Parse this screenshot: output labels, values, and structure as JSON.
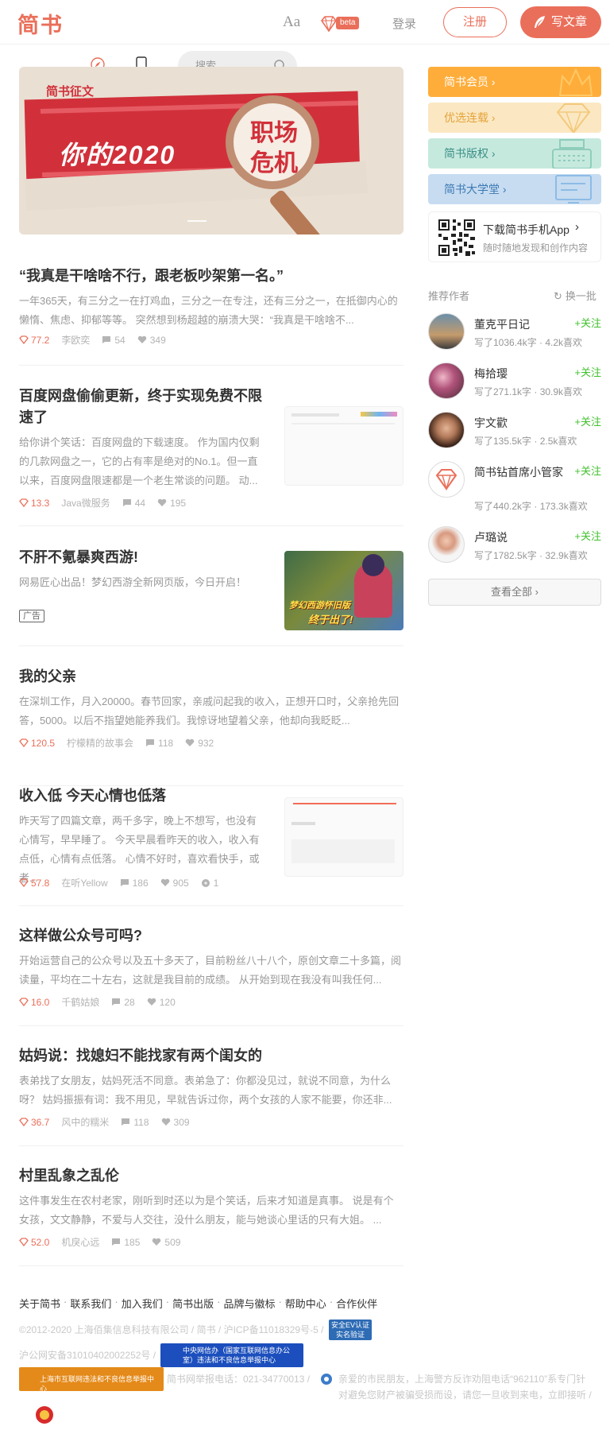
{
  "header": {
    "logo": "简书",
    "font_toggle": "Aa",
    "beta": "beta",
    "login": "登录",
    "register": "注册",
    "write": "写文章"
  },
  "search": {
    "placeholder": "搜索"
  },
  "banner": {
    "tag": "简书征文",
    "headline": "你的2020",
    "lens_line1": "职场",
    "lens_line2": "危机"
  },
  "articles": [
    {
      "title": "“我真是干啥啥不行，跟老板吵架第一名。”",
      "abstract": "一年365天，有三分之一在打鸡血，三分之一在专注，还有三分之一，在抵御内心的懒惰、焦虑、抑郁等等。 突然想到杨超越的崩溃大哭：“我真是干啥啥不...",
      "diamond": "77.2",
      "author": "李欧奕",
      "comments": "54",
      "likes": "349"
    },
    {
      "title": "百度网盘偷偷更新，终于实现免费不限速了",
      "abstract": "给你讲个笑话：百度网盘的下载速度。 作为国内仅剩的几款网盘之一，它的占有率是绝对的No.1。但一直以来，百度网盘限速都是一个老生常谈的问题。 动...",
      "diamond": "13.3",
      "author": "Java微服务",
      "comments": "44",
      "likes": "195"
    },
    {
      "title": "不肝不氪暴爽西游!",
      "abstract": "网易匠心出品！梦幻西游全新网页版，今日开启！",
      "ad": "广告",
      "thumb_line1": "梦幻西游怀旧版",
      "thumb_line2": "终于出了!"
    },
    {
      "title": "我的父亲",
      "abstract": "在深圳工作，月入20000。春节回家，亲戚问起我的收入，正想开口时，父亲抢先回答，5000。以后不指望她能养我们。我惊讶地望着父亲，他却向我眨眨...",
      "diamond": "120.5",
      "author": "柠檬精的故事会",
      "comments": "118",
      "likes": "932"
    },
    {
      "title": "收入低 今天心情也低落",
      "abstract": "昨天写了四篇文章，两千多字，晚上不想写，也没有心情写，早早睡了。 今天早晨看昨天的收入，收入有点低，心情有点低落。 心情不好时，喜欢看快手，或者...",
      "diamond": "57.8",
      "author": "在听Yellow",
      "comments": "186",
      "likes": "905",
      "rewards": "1"
    },
    {
      "title": "这样做公众号可吗?",
      "abstract": "开始运营自己的公众号以及五十多天了，目前粉丝八十八个，原创文章二十多篇，阅读量，平均在二十左右，这就是我目前的成绩。 从开始到现在我没有叫我任何...",
      "diamond": "16.0",
      "author": "千鹤姑娘",
      "comments": "28",
      "likes": "120"
    },
    {
      "title": "姑妈说：找媳妇不能找家有两个闺女的",
      "abstract": "表弟找了女朋友，姑妈死活不同意。表弟急了：你都没见过，就说不同意，为什么呀？ 姑妈振振有词：我不用见，早就告诉过你，两个女孩的人家不能要，你还非...",
      "diamond": "36.7",
      "author": "风中的糯米",
      "comments": "118",
      "likes": "309"
    },
    {
      "title": "村里乱象之乱伦",
      "abstract": "这件事发生在农村老家，刚听到时还以为是个笑话，后来才知道是真事。 说是有个女孩，文文静静，不爱与人交往，没什么朋友，能与她谈心里话的只有大姐。 ...",
      "diamond": "52.0",
      "author": "机戾心远",
      "comments": "185",
      "likes": "509"
    }
  ],
  "sidebar": {
    "boards": [
      {
        "label": "简书会员",
        "color": "#ffad3a",
        "text_color": "#ffffff"
      },
      {
        "label": "优选连载",
        "color": "#fbe8c2",
        "text_color": "#e5a33b"
      },
      {
        "label": "简书版权",
        "color": "#c6e9de",
        "text_color": "#3b8f86"
      },
      {
        "label": "简书大学堂",
        "color": "#c7dcf1",
        "text_color": "#3c78b3"
      }
    ],
    "app_title": "下载简书手机App",
    "app_sub": "随时随地发现和创作内容",
    "recommend_title": "推荐作者",
    "refresh": "换一批",
    "authors": [
      {
        "name": "董克平日记",
        "stats": "写了1036.4k字 · 4.2k喜欢"
      },
      {
        "name": "梅拾璎",
        "stats": "写了271.1k字 · 30.9k喜欢"
      },
      {
        "name": "宇文歡",
        "stats": "写了135.5k字 · 2.5k喜欢"
      },
      {
        "name": "简书钻首席小管家",
        "stats": "写了440.2k字 · 173.3k喜欢"
      },
      {
        "name": "卢璐说",
        "stats": "写了1782.5k字 · 32.9k喜欢"
      }
    ],
    "follow": "关注",
    "view_all": "查看全部"
  },
  "footer": {
    "links": [
      "关于简书",
      "联系我们",
      "加入我们",
      "简书出版",
      "品牌与徽标",
      "帮助中心",
      "合作伙伴"
    ],
    "line1": "©2012-2020 上海佰集信息科技有限公司 / 简书 / 沪ICP备11018329号-5 /",
    "line2": "沪公网安备31010402002252号 /",
    "line3": "简书网举报电话：021-34770013 /",
    "line3b": "亲爱的市民朋友，上海警方反诈劝阻电话“962110”系专门针对避免您财产被骗受损而设，请您一旦收到来电，立即接听 /",
    "badge_cyber": "中央网信办（国家互联网信息办公室）违法和不良信息举报中心",
    "badge_sh": "上海市互联网违法和不良信息举报中心",
    "badge_ev": "安全EV认证 实名验证"
  }
}
